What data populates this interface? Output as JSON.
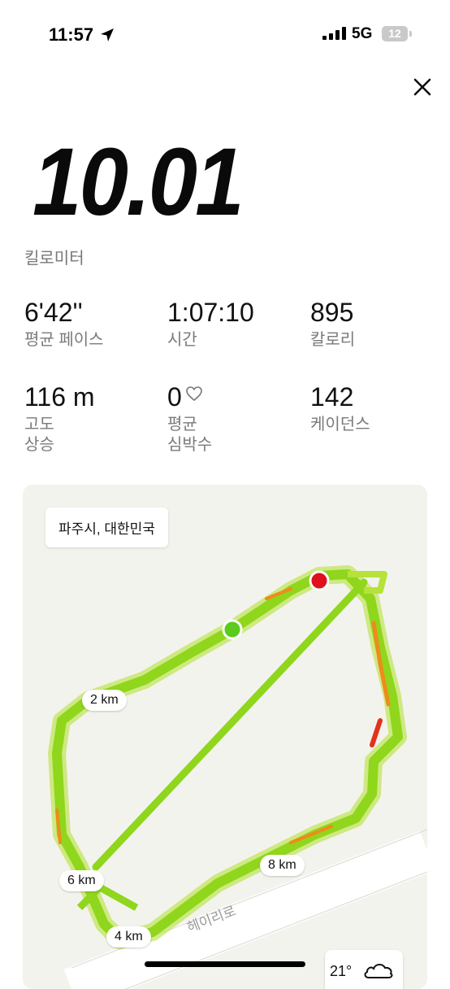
{
  "status_bar": {
    "time": "11:57",
    "network": "5G",
    "battery": "12"
  },
  "summary": {
    "distance": "10.01",
    "distance_unit": "킬로미터"
  },
  "stats": [
    {
      "value": "6'42''",
      "label": "평균 페이스"
    },
    {
      "value": "1:07:10",
      "label": "시간"
    },
    {
      "value": "895",
      "label": "칼로리"
    },
    {
      "value": "116 m",
      "label_line1": "고도",
      "label_line2": "상승"
    },
    {
      "value": "0",
      "label_line1": "평균",
      "label_line2": "심박수"
    },
    {
      "value": "142",
      "label": "케이던스"
    }
  ],
  "map": {
    "location": "파주시, 대한민국",
    "road_name": "헤이리로",
    "km_markers": [
      "2 km",
      "4 km",
      "6 km",
      "8 km"
    ],
    "weather_temp": "21°"
  },
  "colors": {
    "route_main": "#8fd61c",
    "route_fast": "#c6e829",
    "route_slow": "#f08a1c",
    "route_slowest": "#e3321b",
    "start_dot": "#5bcb1d",
    "end_dot": "#e0101e"
  },
  "icons": {
    "location": "location-arrow-icon",
    "signal": "signal-bars-icon",
    "close": "close-icon",
    "heart": "heart-outline-icon",
    "weather": "cloud-icon"
  }
}
